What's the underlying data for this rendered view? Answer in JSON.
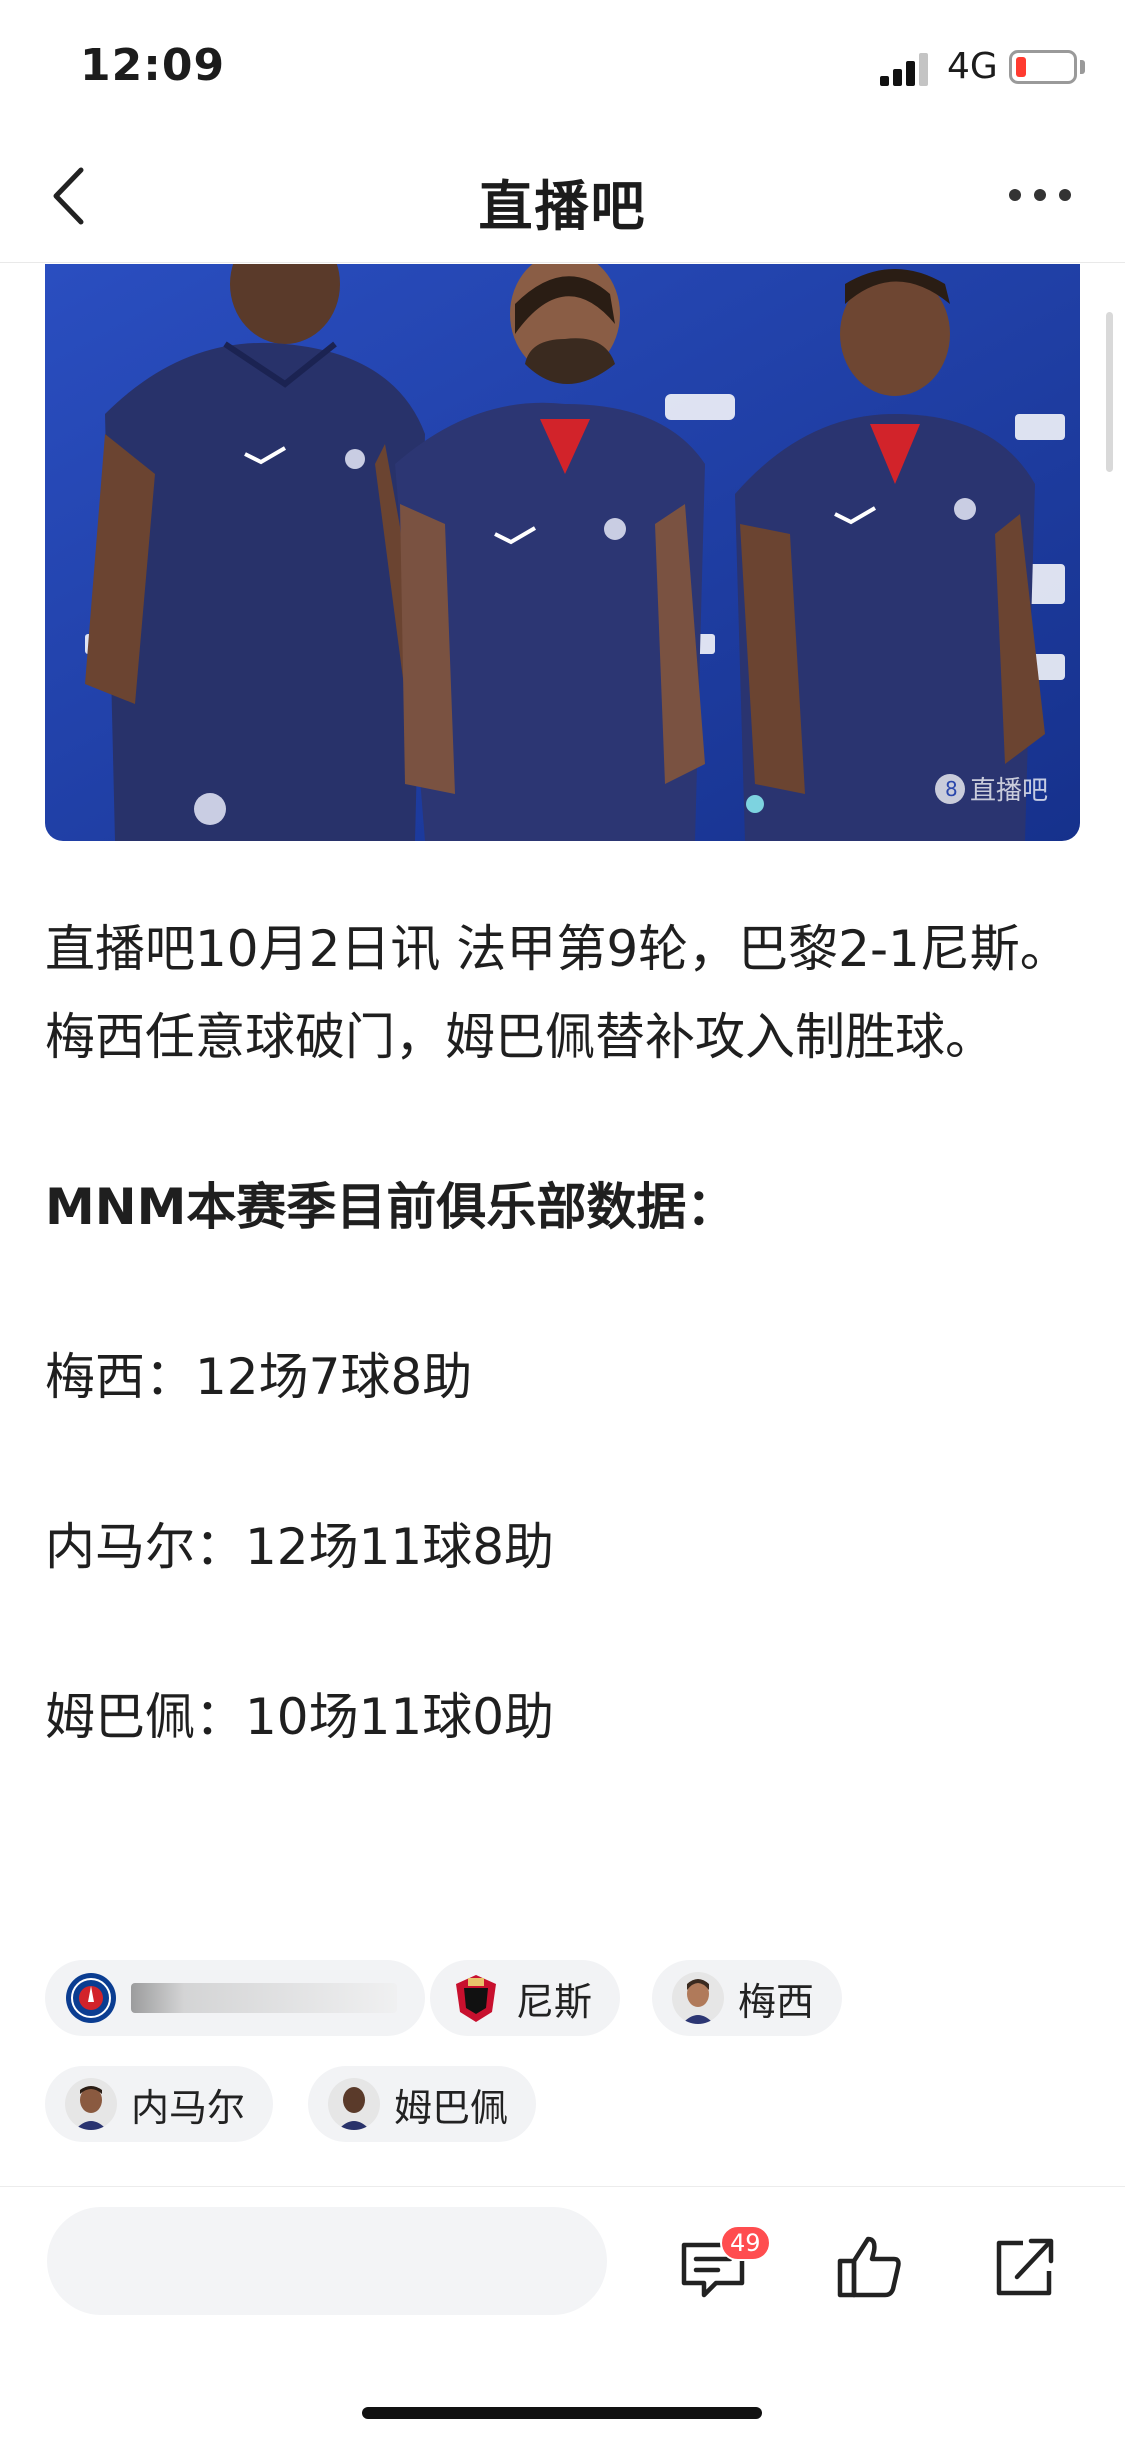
{
  "status_bar": {
    "time": "12:09",
    "network": "4G",
    "battery_color": "#ff3b30"
  },
  "nav": {
    "title": "直播吧",
    "back_icon": "chevron-left-icon",
    "more_icon": "more-horizontal-icon"
  },
  "hero": {
    "colors": {
      "backdrop": "#1f3ea8",
      "shirt": "#28326a"
    },
    "watermark": "8 直播吧"
  },
  "article": {
    "lead": "直播吧10月2日讯 法甲第9轮，巴黎2-1尼斯。梅西任意球破门，姆巴佩替补攻入制胜球。",
    "subhead": "MNM本赛季目前俱乐部数据：",
    "stats": [
      "梅西：12场7球8助",
      "内马尔：12场11球8助",
      "姆巴佩：10场11球0助"
    ]
  },
  "tags": [
    {
      "label": "",
      "icon": "psg-logo-icon"
    },
    {
      "label": "尼斯",
      "icon": "nice-logo-icon"
    },
    {
      "label": "梅西",
      "icon": "messi-avatar"
    },
    {
      "label": "内马尔",
      "icon": "neymar-avatar"
    },
    {
      "label": "姆巴佩",
      "icon": "mbappe-avatar"
    }
  ],
  "bottom_bar": {
    "comment_count": "49",
    "icons": [
      "comment-icon",
      "thumbs-up-icon",
      "share-icon"
    ],
    "badge_color": "#ff4d4f"
  }
}
